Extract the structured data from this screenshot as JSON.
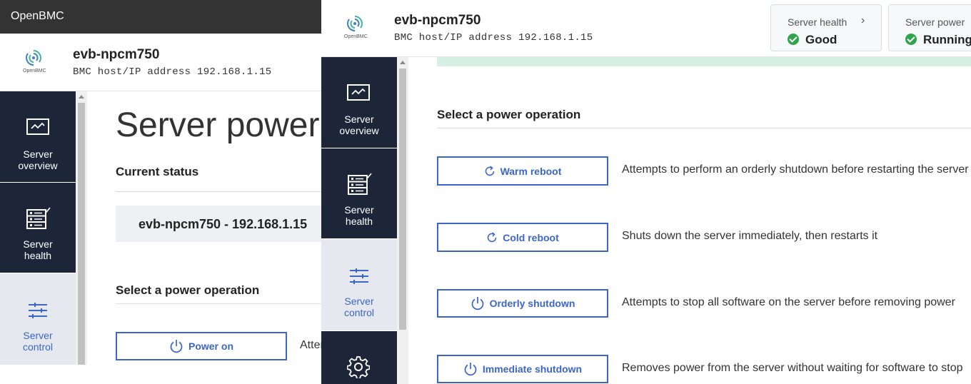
{
  "back_window": {
    "title_bar": "OpenBMC",
    "logo_text": "OpenBMC",
    "host_name": "evb-npcm750",
    "host_address": "BMC host/IP address 192.168.1.15",
    "nav": [
      {
        "label_line1": "Server",
        "label_line2": "overview",
        "icon": "monitor-icon"
      },
      {
        "label_line1": "Server",
        "label_line2": "health",
        "icon": "server-health-icon"
      },
      {
        "label_line1": "Server",
        "label_line2": "control",
        "icon": "sliders-icon",
        "active": true
      }
    ],
    "page_title": "Server power operations",
    "current_status_heading": "Current status",
    "status_value": "evb-npcm750 - 192.168.1.15",
    "power_op_heading": "Select a power operation",
    "power_on_label": "Power on",
    "power_on_desc": "Attempts to power on the server"
  },
  "front_window": {
    "logo_text": "OpenBMC",
    "host_name": "evb-npcm750",
    "host_address": "BMC host/IP address 192.168.1.15",
    "status_cards": [
      {
        "label": "Server health",
        "value": "Good",
        "status_color": "#2ea44f"
      },
      {
        "label": "Server power",
        "value": "Running",
        "status_color": "#2ea44f"
      }
    ],
    "nav": [
      {
        "label_line1": "Server",
        "label_line2": "overview",
        "icon": "monitor-icon"
      },
      {
        "label_line1": "Server",
        "label_line2": "health",
        "icon": "server-health-icon"
      },
      {
        "label_line1": "Server",
        "label_line2": "control",
        "icon": "sliders-icon",
        "active": true
      },
      {
        "label_line1": "",
        "label_line2": "",
        "icon": "gear-icon"
      }
    ],
    "power_op_heading": "Select a power operation",
    "operations": [
      {
        "label": "Warm reboot",
        "icon": "reboot-icon",
        "desc": "Attempts to perform an orderly shutdown before restarting the server"
      },
      {
        "label": "Cold reboot",
        "icon": "reboot-icon",
        "desc": "Shuts down the server immediately, then restarts it"
      },
      {
        "label": "Orderly shutdown",
        "icon": "power-icon",
        "desc": "Attempts to stop all software on the server before removing power"
      },
      {
        "label": "Immediate shutdown",
        "icon": "power-icon",
        "desc": "Removes power from the server without waiting for software to stop"
      }
    ]
  },
  "colors": {
    "nav_bg": "#1c2638",
    "accent": "#3b66c8",
    "success": "#2ea44f"
  }
}
